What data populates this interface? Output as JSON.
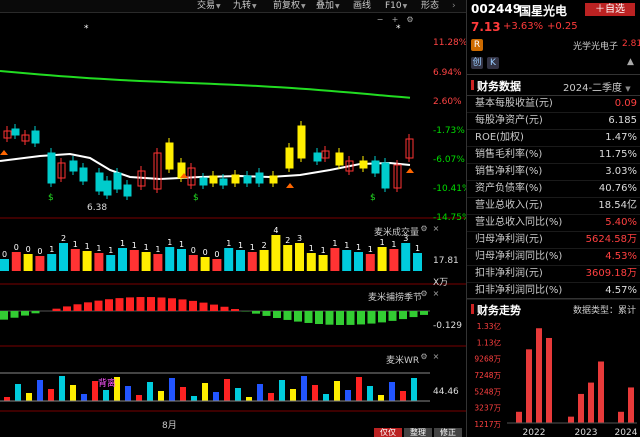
{
  "toolbar": {
    "items": [
      {
        "label": "交易",
        "caret": true
      },
      {
        "label": "九转",
        "caret": true
      },
      {
        "label": "前复权",
        "caret": true
      },
      {
        "label": "叠加",
        "caret": true
      },
      {
        "label": "画线",
        "caret": false
      },
      {
        "label": "F10",
        "caret": true
      },
      {
        "label": "形态",
        "caret": false
      }
    ]
  },
  "main_chart": {
    "price_levels": [
      "11.28%",
      "6.94%",
      "2.60%",
      "-1.73%",
      "-6.07%",
      "-10.41%",
      "-14.75%"
    ],
    "low_marker": "6.38",
    "colors": {
      "ma_line": "#22dd22",
      "ma2_line": "#ffffff",
      "up": "#ff3333",
      "down": "#00cccc",
      "yellow": "#ffee00"
    }
  },
  "volume_panel": {
    "title": "麦米成交量",
    "value": "17.81",
    "unit": "X万",
    "digits": [
      "0",
      "0",
      "0",
      "0",
      "1",
      "2",
      "1",
      "1",
      "1",
      "1",
      "1",
      "1",
      "1",
      "1",
      "1",
      "1",
      "0",
      "0",
      "0",
      "1",
      "1",
      "1",
      "2",
      "4",
      "2",
      "3",
      "1",
      "1",
      "1",
      "1",
      "1",
      "1",
      "1",
      "1",
      "3",
      "1"
    ]
  },
  "wave_panel": {
    "title": "麦米捕捞季节",
    "value": "-0.129"
  },
  "wr_panel": {
    "title": "麦米WR",
    "value": "44.46",
    "tag": "背离"
  },
  "x_axis": {
    "month_label": "8月"
  },
  "bottom_buttons": [
    "仅仅",
    "整理",
    "修正"
  ],
  "stock": {
    "code": "002449",
    "name": "国星光电",
    "price": "7.13",
    "change_pct": "+3.63%",
    "change_amt": "+0.25",
    "add_watch": "自选",
    "badge_r": "R",
    "sector": "光学光电子",
    "sector_value": "2.81",
    "chuang": "创",
    "k": "K"
  },
  "finance": {
    "title": "财务数据",
    "period": "2024-二季度",
    "rows": [
      {
        "k": "基本每股收益(元)",
        "v": "0.09",
        "red": true
      },
      {
        "k": "每股净资产(元)",
        "v": "6.185",
        "red": false
      },
      {
        "k": "ROE(加权)",
        "v": "1.47%",
        "red": false
      },
      {
        "k": "销售毛利率(%)",
        "v": "11.75%",
        "red": false
      },
      {
        "k": "销售净利率(%)",
        "v": "3.03%",
        "red": false
      },
      {
        "k": "资产负债率(%)",
        "v": "40.76%",
        "red": false
      },
      {
        "k": "营业总收入(元)",
        "v": "18.54亿",
        "red": false
      },
      {
        "k": "营业总收入同比(%)",
        "v": "5.40%",
        "red": true
      },
      {
        "k": "归母净利润(元)",
        "v": "5624.58万",
        "red": true
      },
      {
        "k": "归母净利润同比(%)",
        "v": "4.53%",
        "red": true
      },
      {
        "k": "扣非净利润(元)",
        "v": "3609.18万",
        "red": true
      },
      {
        "k": "扣非净利润同比(%)",
        "v": "4.57%",
        "red": false
      }
    ]
  },
  "trend": {
    "title": "财务走势",
    "type_label": "数据类型：累计",
    "y_labels": [
      "1.33亿",
      "1.13亿",
      "9268万",
      "7248万",
      "5248万",
      "3237万",
      "1217万"
    ],
    "x_labels": [
      "2022",
      "2023",
      "2024"
    ]
  },
  "chart_data": {
    "type": "bar",
    "title": "财务走势",
    "categories": [
      "2022-Q1",
      "2022-Q2",
      "2022-Q3",
      "2022-Q4",
      "2023-Q1",
      "2023-Q2",
      "2023-Q3",
      "2023-Q4",
      "2024-Q1",
      "2024-Q2"
    ],
    "values": [
      2600,
      10300,
      12900,
      11700,
      2000,
      4800,
      6200,
      8800,
      2600,
      5600
    ],
    "ylabel": "万",
    "ylim": [
      1217,
      13300
    ]
  }
}
